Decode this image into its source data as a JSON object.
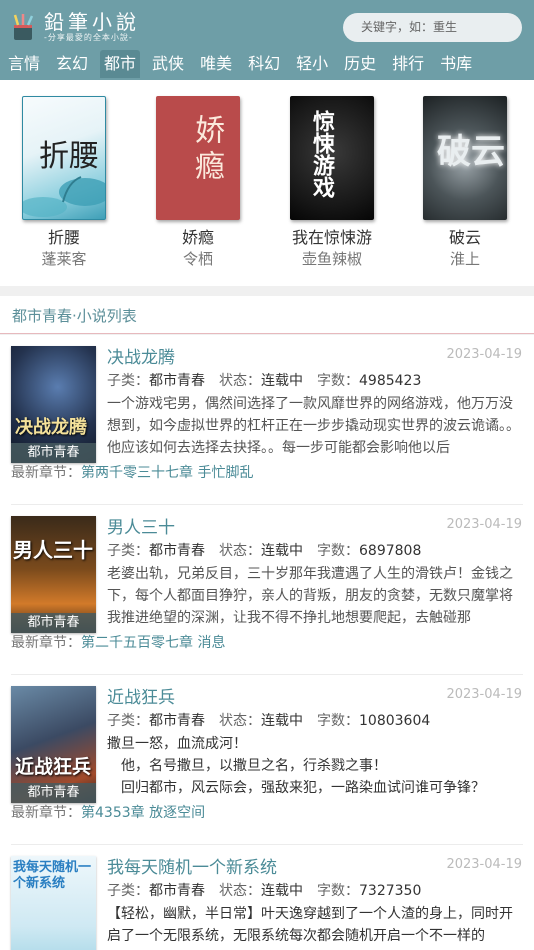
{
  "header": {
    "logo_name": "鉛筆小說",
    "logo_slogan": "-分享最愛的全本小說-",
    "search_placeholder": "关键字，如：重生"
  },
  "nav": [
    {
      "label": "言情"
    },
    {
      "label": "玄幻"
    },
    {
      "label": "都市",
      "active": true
    },
    {
      "label": "武侠"
    },
    {
      "label": "唯美"
    },
    {
      "label": "科幻"
    },
    {
      "label": "轻小"
    },
    {
      "label": "历史"
    },
    {
      "label": "排行"
    },
    {
      "label": "书库"
    }
  ],
  "featured": [
    {
      "title": "折腰",
      "author": "蓬莱客",
      "cover_text": "折腰"
    },
    {
      "title": "娇瘾",
      "author": "令栖",
      "cover_text": "娇瘾"
    },
    {
      "title": "我在惊悚游",
      "author": "壶鱼辣椒",
      "cover_text": "惊悚游戏"
    },
    {
      "title": "破云",
      "author": "淮上",
      "cover_text": "破云"
    }
  ],
  "list_title": "都市青春·小说列表",
  "labels": {
    "category": "子类：",
    "status": "状态：",
    "words": "字数：",
    "latest": "最新章节："
  },
  "books": [
    {
      "title": "决战龙腾",
      "date": "2023-04-19",
      "category": "都市青春",
      "status": "连载中",
      "words": "4985423",
      "genre": "都市青春",
      "cover_text": "决战龙腾",
      "desc": "一个游戏宅男，偶然间选择了一款风靡世界的网络游戏，他万万没想到，如今虚拟世界的杠杆正在一步步撬动现实世界的波云诡谲。。他应该如何去选择去抉择。。每一步可能都会影响他以后",
      "latest": "第两千零三十七章 手忙脚乱"
    },
    {
      "title": "男人三十",
      "date": "2023-04-19",
      "category": "都市青春",
      "status": "连载中",
      "words": "6897808",
      "genre": "都市青春",
      "cover_text": "男人三十",
      "desc": "老婆出轨，兄弟反目，三十岁那年我遭遇了人生的滑铁卢！金钱之下，每个人都面目狰狞，亲人的背叛，朋友的贪婪，无数只魔掌将我推进绝望的深渊，让我不得不挣扎地想要爬起，去触碰那",
      "latest": "第二千五百零七章 消息"
    },
    {
      "title": "近战狂兵",
      "date": "2023-04-19",
      "category": "都市青春",
      "status": "连载中",
      "words": "10803604",
      "genre": "都市青春",
      "cover_text": "近战狂兵",
      "desc_lines": [
        "撒旦一怒，血流成河！",
        "　他，名号撒旦，以撒旦之名，行杀戮之事！",
        "　回归都市，风云际会，强敌来犯，一路染血试问谁可争锋？"
      ],
      "latest": "第4353章 放逐空间"
    },
    {
      "title": "我每天随机一个新系统",
      "date": "2023-04-19",
      "category": "都市青春",
      "status": "连载中",
      "words": "7327350",
      "genre": "都市青春",
      "cover_text": "我每天随机一个新系统",
      "desc": "【轻松，幽默，半日常】叶天逸穿越到了一个人渣的身上，同时开启了一个无限系统，无限系统每次都会随机开启一个不一样的",
      "latest": ""
    }
  ],
  "colors": {
    "header_bg": "#6e9ea7",
    "accent": "#4b8b97"
  }
}
